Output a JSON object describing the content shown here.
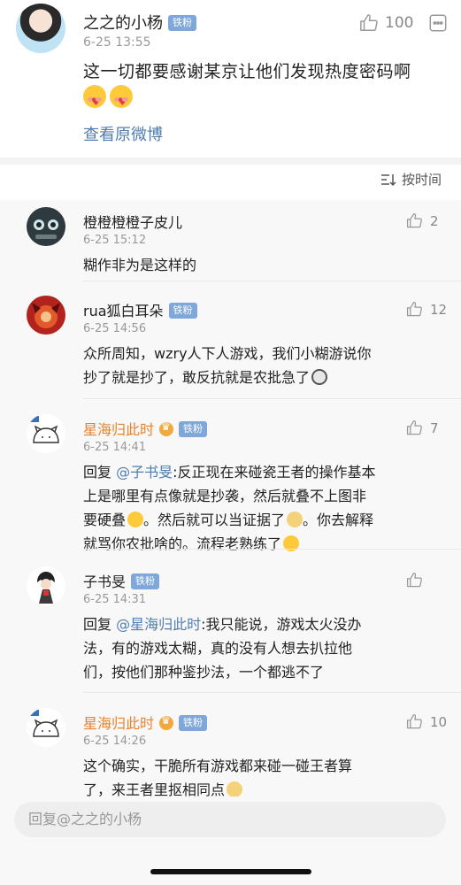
{
  "post": {
    "author": "之之的小杨",
    "badge": "铁粉",
    "time": "6-25 13:55",
    "text": "这一切都要感谢某京让他们发现热度密码啊",
    "like_count": "100",
    "view_original": "查看原微博"
  },
  "sort": {
    "label": "按时间"
  },
  "comments": [
    {
      "name": "橙橙橙橙子皮儿",
      "time": "6-25 15:12",
      "like_count": "2",
      "body": "糊作非为是这样的"
    },
    {
      "name": "rua狐白耳朵",
      "badge": "铁粉",
      "time": "6-25 14:56",
      "like_count": "12",
      "body_line1": "众所周知，wzry人下人游戏，我们小糊游说你",
      "body_line2": "抄了就是抄了，敢反抗就是农批急了"
    },
    {
      "name": "星海归此时",
      "badge": "铁粉",
      "time": "6-25 14:41",
      "like_count": "7",
      "reply_prefix": "回复",
      "mention": "@子书旻",
      "body_line1_rest": ":反正现在来碰瓷王者的操作基本",
      "body_line2": "上是哪里有点像就是抄袭，然后就叠不上图非",
      "body_line3a": "要硬叠",
      "body_line3b": "。然后就可以当证据了",
      "body_line3c": "。你去解释",
      "body_line4": "就骂你农批啥的。流程老熟练了"
    },
    {
      "name": "子书旻",
      "badge": "铁粉",
      "time": "6-25 14:31",
      "reply_prefix": "回复",
      "mention": "@星海归此时",
      "body_line1_rest": ":我只能说，游戏太火没办",
      "body_line2": "法，有的游戏太糊，真的没有人想去扒拉他",
      "body_line3": "们，按他们那种鉴抄法，一个都逃不了"
    },
    {
      "name": "星海归此时",
      "badge": "铁粉",
      "time": "6-25 14:26",
      "like_count": "10",
      "body_line1": "这个确实，干脆所有游戏都来碰一碰王者算",
      "body_line2": "了，来王者里抠相同点"
    }
  ],
  "reply_bar": {
    "placeholder": "回复@之之的小杨"
  },
  "colors": {
    "link": "#507daf",
    "badge": "#7fa7da",
    "orange_name": "#e8822c"
  }
}
